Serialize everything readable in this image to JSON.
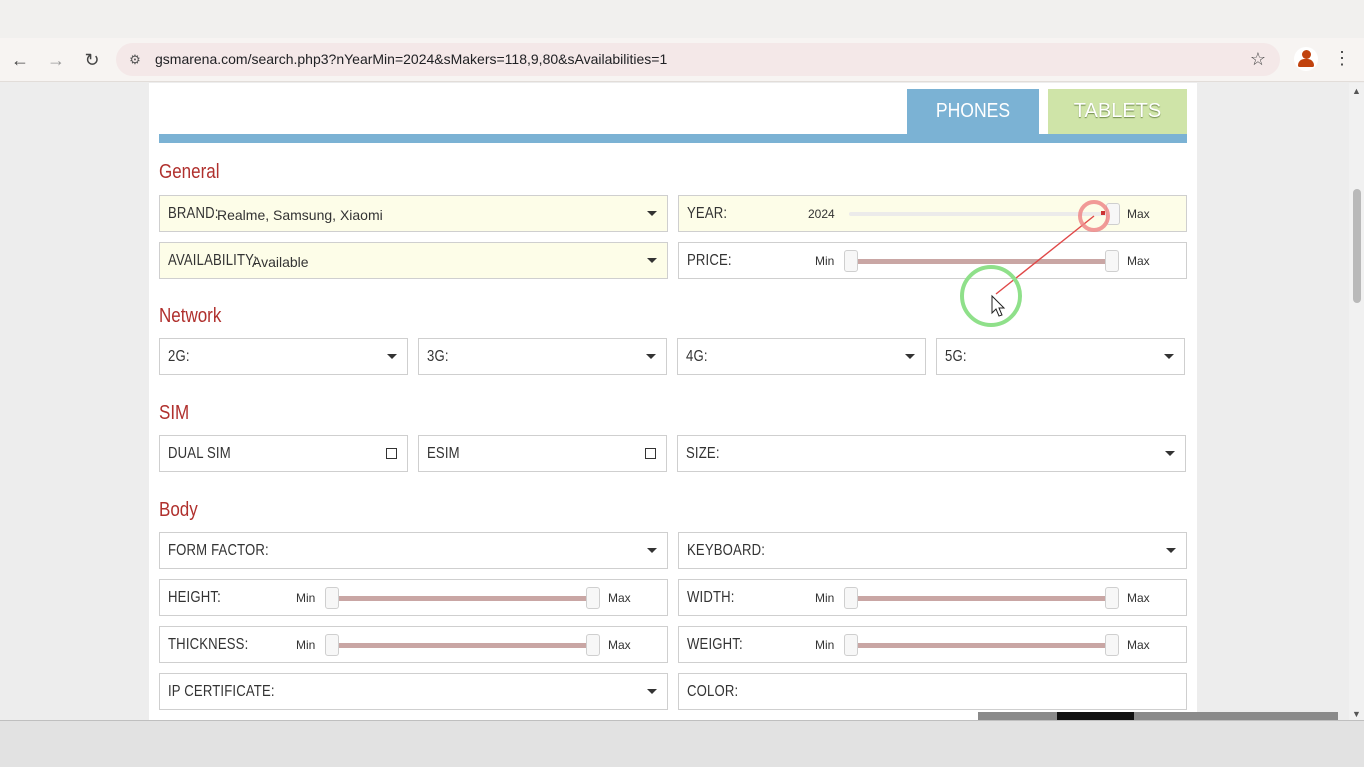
{
  "browser": {
    "url": "gsmarena.com/search.php3?nYearMin=2024&sMakers=118,9,80&sAvailabilities=1"
  },
  "tabs": {
    "phones": "PHONES",
    "tablets": "TABLETS"
  },
  "sections": {
    "general": "General",
    "network": "Network",
    "sim": "SIM",
    "body": "Body"
  },
  "fields": {
    "brand": {
      "label": "BRAND:",
      "value": "Realme, Samsung, Xiaomi"
    },
    "availability": {
      "label": "AVAILABILITY:",
      "value": "Available"
    },
    "year": {
      "label": "YEAR:",
      "min": "2024",
      "max": "Max",
      "level": 1.0
    },
    "price": {
      "label": "PRICE:",
      "min": "Min",
      "max": "Max"
    },
    "g2": {
      "label": "2G:"
    },
    "g3": {
      "label": "3G:"
    },
    "g4": {
      "label": "4G:"
    },
    "g5": {
      "label": "5G:"
    },
    "dual_sim": {
      "label": "DUAL SIM"
    },
    "esim": {
      "label": "ESIM"
    },
    "size": {
      "label": "SIZE:"
    },
    "form_factor": {
      "label": "FORM FACTOR:"
    },
    "keyboard": {
      "label": "KEYBOARD:"
    },
    "height": {
      "label": "HEIGHT:",
      "min": "Min",
      "max": "Max"
    },
    "width": {
      "label": "WIDTH:",
      "min": "Min",
      "max": "Max"
    },
    "thickness": {
      "label": "THICKNESS:",
      "min": "Min",
      "max": "Max"
    },
    "weight": {
      "label": "WEIGHT:",
      "min": "Min",
      "max": "Max"
    },
    "ip_certificate": {
      "label": "IP CERTIFICATE:"
    },
    "color": {
      "label": "COLOR:"
    }
  },
  "colors": {
    "accent_blue": "#7bb2d4",
    "tablets_green": "#cfe4a8",
    "section_red": "#b0302d",
    "field_yellow": "#fdfde8"
  }
}
